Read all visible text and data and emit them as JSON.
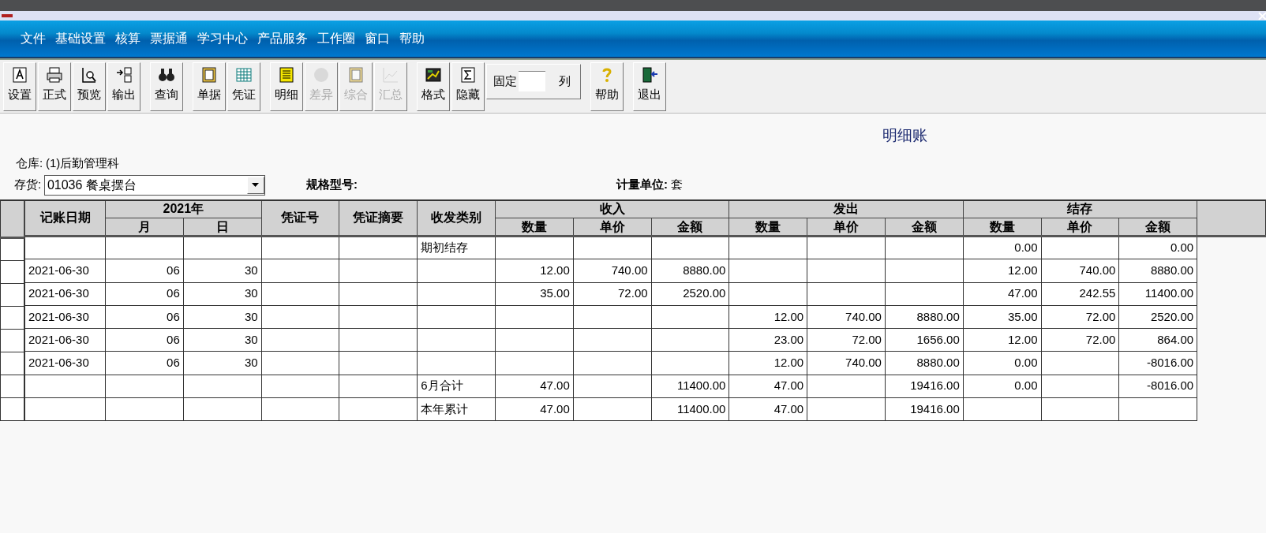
{
  "menu": [
    "文件",
    "基础设置",
    "核算",
    "票据通",
    "学习中心",
    "产品服务",
    "工作圈",
    "窗口",
    "帮助"
  ],
  "toolbar": [
    {
      "items": [
        {
          "kind": "button",
          "label": "设置",
          "disabled": false
        },
        {
          "kind": "button",
          "label": "正式",
          "disabled": false
        },
        {
          "kind": "button",
          "label": "预览",
          "disabled": false
        },
        {
          "kind": "button",
          "label": "输出",
          "disabled": false
        }
      ]
    },
    {
      "items": [
        {
          "kind": "button",
          "label": "查询",
          "disabled": false
        }
      ]
    },
    {
      "items": [
        {
          "kind": "button",
          "label": "单据",
          "disabled": false
        },
        {
          "kind": "button",
          "label": "凭证",
          "disabled": false
        }
      ]
    },
    {
      "items": [
        {
          "kind": "button",
          "label": "明细",
          "disabled": false
        },
        {
          "kind": "button",
          "label": "差异",
          "disabled": true
        },
        {
          "kind": "button",
          "label": "综合",
          "disabled": true
        },
        {
          "kind": "button",
          "label": "汇总",
          "disabled": true
        }
      ]
    },
    {
      "items": [
        {
          "kind": "button",
          "label": "格式",
          "disabled": false
        },
        {
          "kind": "button",
          "label": "隐藏",
          "disabled": false
        },
        {
          "kind": "fixed",
          "label": "固定",
          "suffix": "列"
        }
      ]
    },
    {
      "items": [
        {
          "kind": "button",
          "label": "帮助",
          "disabled": false
        }
      ]
    },
    {
      "items": [
        {
          "kind": "button",
          "label": "退出",
          "disabled": false
        }
      ]
    }
  ],
  "report_title": "明细账",
  "warehouse": {
    "label": "仓库:",
    "value": "(1)后勤管理科"
  },
  "inventory": {
    "label": "存货:",
    "value": "01036 餐桌摆台"
  },
  "spec": {
    "label": "规格型号:"
  },
  "unit": {
    "label": "计量单位:",
    "value": "套"
  },
  "table": {
    "columns": [
      {
        "label": "记账日期"
      },
      {
        "label": "2021年",
        "colspan": 2,
        "children": [
          "月",
          "日"
        ]
      },
      {
        "label": "凭证号"
      },
      {
        "label": "凭证摘要"
      },
      {
        "label": "收发类别"
      },
      {
        "label": "收入",
        "colspan": 3,
        "children": [
          "数量",
          "单价",
          "金额"
        ]
      },
      {
        "label": "发出",
        "colspan": 3,
        "children": [
          "数量",
          "单价",
          "金额"
        ]
      },
      {
        "label": "结存",
        "colspan": 3,
        "children": [
          "数量",
          "单价",
          "金额"
        ]
      }
    ],
    "rows": [
      {
        "cells": [
          null,
          null,
          null,
          null,
          null,
          "期初结存",
          null,
          null,
          null,
          null,
          null,
          null,
          "0.00",
          null,
          "0.00"
        ]
      },
      {
        "cells": [
          "2021-06-30",
          "06",
          "30",
          null,
          null,
          null,
          "12.00",
          "740.00",
          "8880.00",
          null,
          null,
          null,
          "12.00",
          "740.00",
          "8880.00"
        ]
      },
      {
        "cells": [
          "2021-06-30",
          "06",
          "30",
          null,
          null,
          null,
          "35.00",
          "72.00",
          "2520.00",
          null,
          null,
          null,
          "47.00",
          "242.55",
          "11400.00"
        ]
      },
      {
        "cells": [
          "2021-06-30",
          "06",
          "30",
          null,
          null,
          null,
          null,
          null,
          null,
          "12.00",
          "740.00",
          "8880.00",
          "35.00",
          "72.00",
          "2520.00"
        ]
      },
      {
        "cells": [
          "2021-06-30",
          "06",
          "30",
          null,
          null,
          null,
          null,
          null,
          null,
          "23.00",
          "72.00",
          "1656.00",
          "12.00",
          "72.00",
          "864.00"
        ]
      },
      {
        "cells": [
          "2021-06-30",
          "06",
          "30",
          null,
          null,
          null,
          null,
          null,
          null,
          "12.00",
          "740.00",
          "8880.00",
          "0.00",
          null,
          "-8016.00"
        ]
      },
      {
        "cells": [
          null,
          null,
          null,
          null,
          null,
          "6月合计",
          "47.00",
          null,
          "11400.00",
          "47.00",
          null,
          "19416.00",
          "0.00",
          null,
          "-8016.00"
        ]
      },
      {
        "cells": [
          null,
          null,
          null,
          null,
          null,
          "本年累计",
          "47.00",
          null,
          "11400.00",
          "47.00",
          null,
          "19416.00",
          null,
          null,
          null
        ]
      }
    ]
  }
}
